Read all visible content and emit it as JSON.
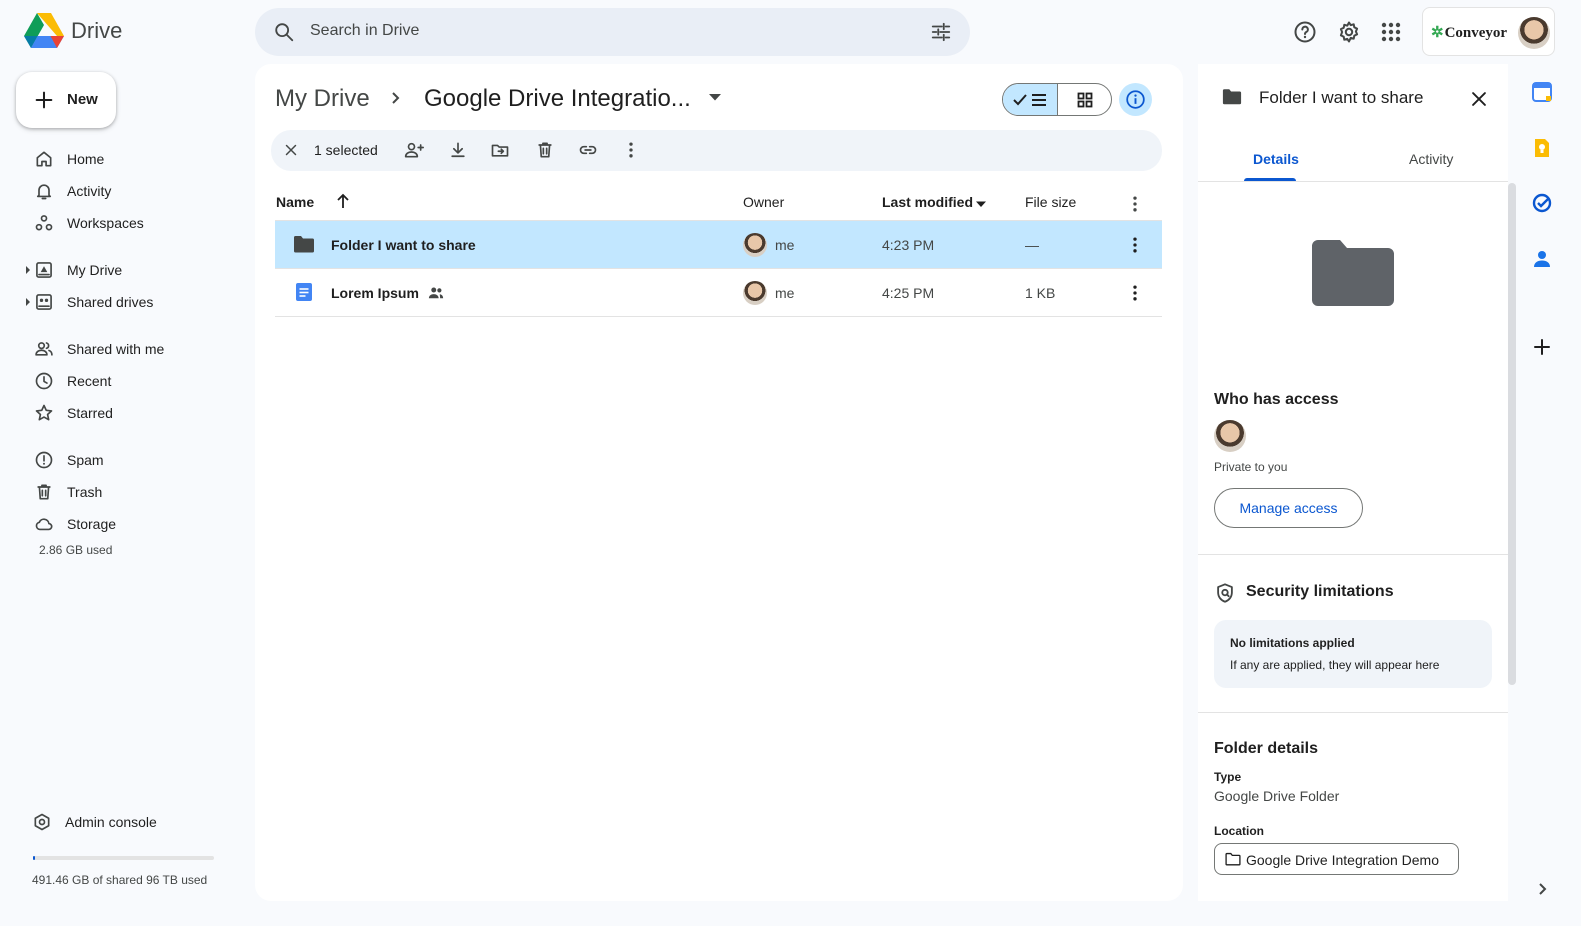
{
  "app": {
    "name": "Drive"
  },
  "search": {
    "placeholder": "Search in Drive"
  },
  "account": {
    "org": "Conveyor"
  },
  "new_button": {
    "label": "New"
  },
  "nav": {
    "primary": [
      {
        "label": "Home",
        "icon": "home-icon"
      },
      {
        "label": "Activity",
        "icon": "bell-icon"
      },
      {
        "label": "Workspaces",
        "icon": "workspaces-icon"
      }
    ],
    "drives": [
      {
        "label": "My Drive",
        "icon": "my-drive-icon"
      },
      {
        "label": "Shared drives",
        "icon": "shared-drives-icon"
      }
    ],
    "secondary": [
      {
        "label": "Shared with me",
        "icon": "people-icon"
      },
      {
        "label": "Recent",
        "icon": "clock-icon"
      },
      {
        "label": "Starred",
        "icon": "star-icon"
      }
    ],
    "tertiary": [
      {
        "label": "Spam",
        "icon": "spam-icon"
      },
      {
        "label": "Trash",
        "icon": "trash-icon"
      },
      {
        "label": "Storage",
        "icon": "cloud-icon"
      }
    ],
    "storage_used": "2.86 GB used",
    "admin_console": "Admin console",
    "quota": {
      "text": "491.46 GB of shared 96 TB used",
      "fraction": 0.005
    }
  },
  "main": {
    "breadcrumb": {
      "root": "My Drive",
      "current": "Google Drive Integratio..."
    },
    "selection": {
      "count": "1 selected"
    },
    "columns": {
      "name": "Name",
      "owner": "Owner",
      "modified": "Last modified",
      "size": "File size"
    },
    "rows": [
      {
        "name": "Folder I want to share",
        "owner": "me",
        "modified": "4:23 PM",
        "size": "—",
        "type": "folder",
        "shared": false,
        "selected": true
      },
      {
        "name": "Lorem Ipsum",
        "owner": "me",
        "modified": "4:25 PM",
        "size": "1 KB",
        "type": "doc",
        "shared": true,
        "selected": false
      }
    ]
  },
  "details": {
    "title": "Folder I want to share",
    "tabs": {
      "details": "Details",
      "activity": "Activity"
    },
    "access": {
      "title": "Who has access",
      "text": "Private to you",
      "manage": "Manage access"
    },
    "security": {
      "title": "Security limitations",
      "headline": "No limitations applied",
      "note": "If any are applied, they will appear here"
    },
    "folder_details": {
      "title": "Folder details",
      "type_label": "Type",
      "type_value": "Google Drive Folder",
      "location_label": "Location",
      "location_value": "Google Drive Integration Demo"
    }
  },
  "colors": {
    "accent": "#0b57d0",
    "selected_bg": "#c2e7ff",
    "surface": "#f8fafd"
  }
}
